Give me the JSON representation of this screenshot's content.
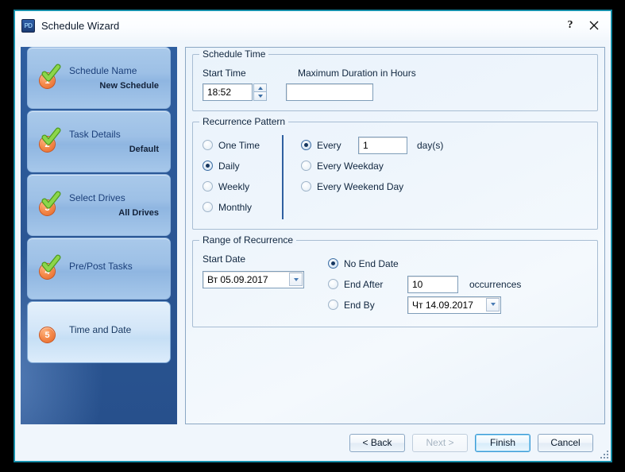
{
  "window": {
    "title": "Schedule Wizard",
    "app_icon": "pd-app-icon",
    "icon_text": "PD",
    "help_label": "?",
    "close_label": "✕"
  },
  "sidebar": {
    "steps": [
      {
        "number": "1",
        "title": "Schedule Name",
        "sub": "New Schedule",
        "state": "completed"
      },
      {
        "number": "2",
        "title": "Task Details",
        "sub": "Default",
        "state": "completed"
      },
      {
        "number": "3",
        "title": "Select Drives",
        "sub": "All Drives",
        "state": "completed"
      },
      {
        "number": "4",
        "title": "Pre/Post Tasks",
        "sub": "",
        "state": "completed"
      },
      {
        "number": "5",
        "title": "Time and Date",
        "sub": "",
        "state": "active"
      }
    ]
  },
  "schedule_time": {
    "legend": "Schedule Time",
    "start_time_label": "Start Time",
    "start_time_value": "18:52",
    "max_duration_label": "Maximum Duration in Hours",
    "max_duration_value": "",
    "max_duration_placeholder": ""
  },
  "recurrence_pattern": {
    "legend": "Recurrence Pattern",
    "frequency_options": [
      {
        "label": "One Time",
        "selected": false
      },
      {
        "label": "Daily",
        "selected": true
      },
      {
        "label": "Weekly",
        "selected": false
      },
      {
        "label": "Monthly",
        "selected": false
      }
    ],
    "daily_options": [
      {
        "label": "Every",
        "selected": true
      },
      {
        "label": "Every Weekday",
        "selected": false
      },
      {
        "label": "Every Weekend Day",
        "selected": false
      }
    ],
    "every_value": "1",
    "every_unit": "day(s)"
  },
  "range_of_recurrence": {
    "legend": "Range of Recurrence",
    "start_date_label": "Start Date",
    "start_date_value": "Вт 05.09.2017",
    "end_options": [
      {
        "label": "No End Date",
        "selected": true
      },
      {
        "label": "End After",
        "selected": false
      },
      {
        "label": "End By",
        "selected": false
      }
    ],
    "occurrences_value": "10",
    "occurrences_label": "occurrences",
    "end_by_value": "Чт 14.09.2017"
  },
  "footer": {
    "back_label": "< Back",
    "next_label": "Next >",
    "finish_label": "Finish",
    "cancel_label": "Cancel"
  },
  "colors": {
    "accent": "#2f5fa0",
    "badge": "#e2672a",
    "check": "#79c143",
    "default_button_border": "#3c9ad6",
    "window_border": "#1b9ab5"
  }
}
